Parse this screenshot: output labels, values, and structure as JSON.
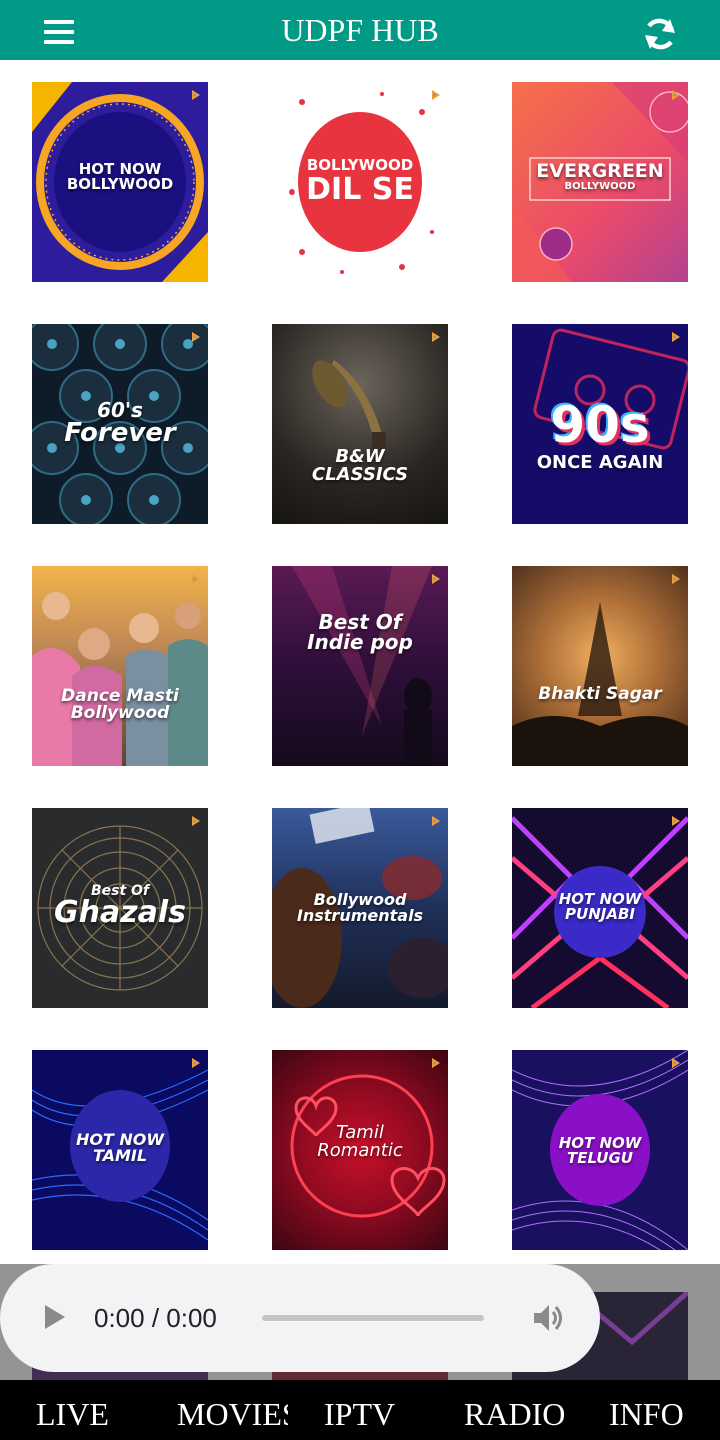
{
  "header": {
    "title": "UDPF HUB",
    "menu_icon": "hamburger-menu-icon",
    "refresh_icon": "refresh-icon",
    "background": "#009a86"
  },
  "tiles": [
    {
      "lines": [
        "HOT NOW",
        "BOLLYWOOD"
      ]
    },
    {
      "lines": [
        "BOLLYWOOD",
        "DIL SE"
      ]
    },
    {
      "lines": [
        "EVERGREEN",
        "BOLLYWOOD"
      ]
    },
    {
      "lines": [
        "60's",
        "Forever"
      ]
    },
    {
      "lines": [
        "B&W",
        "CLASSICS"
      ]
    },
    {
      "lines": [
        "90s",
        "ONCE AGAIN"
      ]
    },
    {
      "lines": [
        "Dance Masti",
        "Bollywood"
      ]
    },
    {
      "lines": [
        "Best Of",
        "Indie pop"
      ]
    },
    {
      "lines": [
        "Bhakti Sagar"
      ]
    },
    {
      "lines": [
        "Best Of",
        "Ghazals"
      ]
    },
    {
      "lines": [
        "Bollywood",
        "Instrumentals"
      ]
    },
    {
      "lines": [
        "HOT NOW",
        "PUNJABI"
      ]
    },
    {
      "lines": [
        "HOT NOW",
        "TAMIL"
      ]
    },
    {
      "lines": [
        "Tamil",
        "Romantic"
      ]
    },
    {
      "lines": [
        "HOT NOW",
        "TELUGU"
      ]
    }
  ],
  "player": {
    "time": "0:00 / 0:00",
    "progress": 0,
    "play_icon": "play-icon",
    "volume_icon": "volume-icon"
  },
  "nav": {
    "items": [
      "LIVE",
      "MOVIES",
      "IPTV",
      "RADIO",
      "INFO"
    ]
  }
}
